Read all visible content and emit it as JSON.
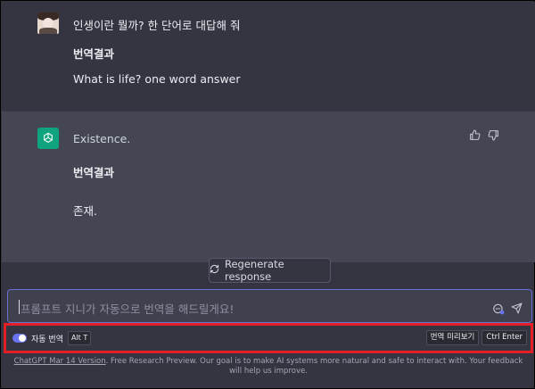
{
  "conversation": {
    "user_message": {
      "prompt": "인생이란 뭘까? 한 단어로 대답해 줘",
      "translation_header": "번역결과",
      "translation": "What is life? one word answer"
    },
    "bot_message": {
      "answer": "Existence.",
      "translation_header": "번역결과",
      "translation": "존재."
    }
  },
  "regenerate_label": "Regenerate response",
  "input": {
    "placeholder": "프롬프트 지니가 자동으로 번역을 해드릴게요!"
  },
  "toolbar": {
    "auto_translate_label": "자동 번역",
    "auto_translate_shortcut": "Alt T",
    "auto_translate_on": true,
    "preview_label": "번역 미리보기",
    "preview_shortcut": "Ctrl Enter"
  },
  "footer": {
    "version_link": "ChatGPT Mar 14 Version",
    "text": ". Free Research Preview. Our goal is to make AI systems more natural and safe to interact with. Your feedback will help us improve."
  },
  "colors": {
    "accent": "#6b74f0",
    "bot_brand": "#10a37f",
    "highlight_border": "#e21f26"
  }
}
